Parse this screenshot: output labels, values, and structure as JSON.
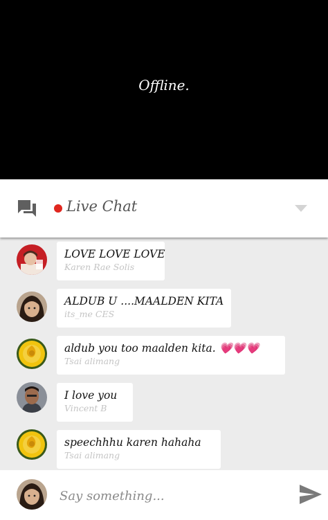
{
  "player": {
    "status_text": "Offline."
  },
  "chat_header": {
    "title": "Live Chat",
    "icon": "chat-bubbles-icon",
    "live_indicator_color": "#e0271f",
    "dropdown_icon": "caret-down-icon"
  },
  "messages": [
    {
      "text": "LOVE LOVE LOVE",
      "author": "Karen Rae Solis",
      "avatar": "avatar-woman-red-background"
    },
    {
      "text": "ALDUB U ....MAALDEN KITA",
      "author": "its_me CES",
      "avatar": "avatar-girl-photo"
    },
    {
      "text": "aldub you too maalden kita.",
      "emoji": "💗💗💗",
      "author": "Tsai alimang",
      "avatar": "avatar-yellow-rose"
    },
    {
      "text": "I love you",
      "author": "Vincent B",
      "avatar": "avatar-man-photo"
    },
    {
      "text": "speechhhu karen hahaha",
      "author": "Tsai alimang",
      "avatar": "avatar-yellow-rose"
    }
  ],
  "composer": {
    "placeholder": "Say something...",
    "value": "",
    "avatar": "avatar-girl-photo",
    "send_icon": "send-arrow-icon"
  }
}
